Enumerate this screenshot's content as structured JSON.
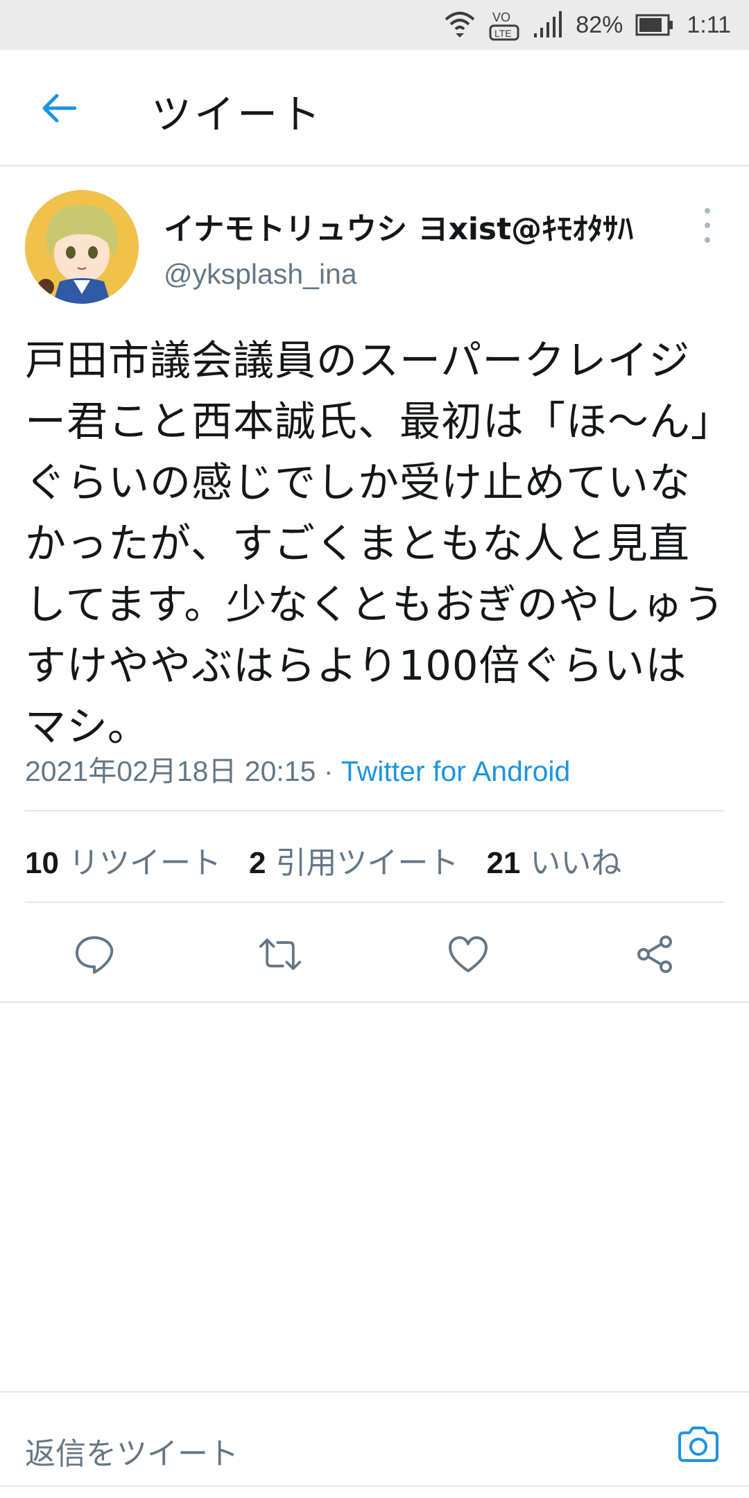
{
  "status_bar": {
    "battery_percent": "82%",
    "time": "1:11",
    "icons": [
      "wifi-icon",
      "volte-icon",
      "signal-icon",
      "battery-icon"
    ]
  },
  "header": {
    "title": "ツイート",
    "back_icon": "arrow-left-icon"
  },
  "tweet": {
    "author_name": "イナモトリュウシ ヨxist@ｷﾓｵﾀｻﾊ",
    "author_handle": "@yksplash_ina",
    "text": "戸田市議会議員のスーパークレイジー君こと西本誠氏、最初は「ほ〜ん」ぐらいの感じでしか受け止めていなかったが、すごくまともな人と見直してます。少なくともおぎのやしゅうすけややぶはらより100倍ぐらいはマシ。",
    "timestamp": "2021年02月18日 20:15",
    "separator": " · ",
    "source": "Twitter for Android"
  },
  "stats": {
    "retweets_count": "10",
    "retweets_label": "リツイート",
    "quotes_count": "2",
    "quotes_label": "引用ツイート",
    "likes_count": "21",
    "likes_label": "いいね"
  },
  "actions": [
    "reply-icon",
    "retweet-icon",
    "like-icon",
    "share-icon"
  ],
  "reply_bar": {
    "placeholder": "返信をツイート",
    "camera_icon": "camera-icon"
  },
  "colors": {
    "accent": "#1b95e0",
    "muted": "#657786",
    "divider": "#e1e8ed",
    "status_bar_bg": "#ebebeb"
  }
}
